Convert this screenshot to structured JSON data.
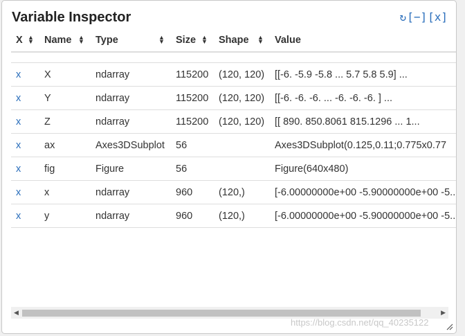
{
  "title": "Variable Inspector",
  "controls": {
    "refresh": "↻",
    "collapse": "[−]",
    "close": "[x]"
  },
  "columns": [
    "X",
    "Name",
    "Type",
    "Size",
    "Shape",
    "Value"
  ],
  "rows": [
    {
      "del": "x",
      "name": "X",
      "type": "ndarray",
      "size": "115200",
      "shape": "(120, 120)",
      "value": "[[-6.  -5.9 -5.8 ...  5.7  5.8  5.9] ..."
    },
    {
      "del": "x",
      "name": "Y",
      "type": "ndarray",
      "size": "115200",
      "shape": "(120, 120)",
      "value": "[[-6.  -6.  -6.  ... -6.  -6.  -6. ] ..."
    },
    {
      "del": "x",
      "name": "Z",
      "type": "ndarray",
      "size": "115200",
      "shape": "(120, 120)",
      "value": "[[ 890.        850.8061    815.1296   ...  1..."
    },
    {
      "del": "x",
      "name": "ax",
      "type": "Axes3DSubplot",
      "size": "56",
      "shape": "",
      "value": "Axes3DSubplot(0.125,0.11;0.775x0.77"
    },
    {
      "del": "x",
      "name": "fig",
      "type": "Figure",
      "size": "56",
      "shape": "",
      "value": "Figure(640x480)"
    },
    {
      "del": "x",
      "name": "x",
      "type": "ndarray",
      "size": "960",
      "shape": "(120,)",
      "value": "[-6.00000000e+00 -5.90000000e+00 -5..."
    },
    {
      "del": "x",
      "name": "y",
      "type": "ndarray",
      "size": "960",
      "shape": "(120,)",
      "value": "[-6.00000000e+00 -5.90000000e+00 -5..."
    }
  ],
  "watermark": "https://blog.csdn.net/qq_40235122"
}
